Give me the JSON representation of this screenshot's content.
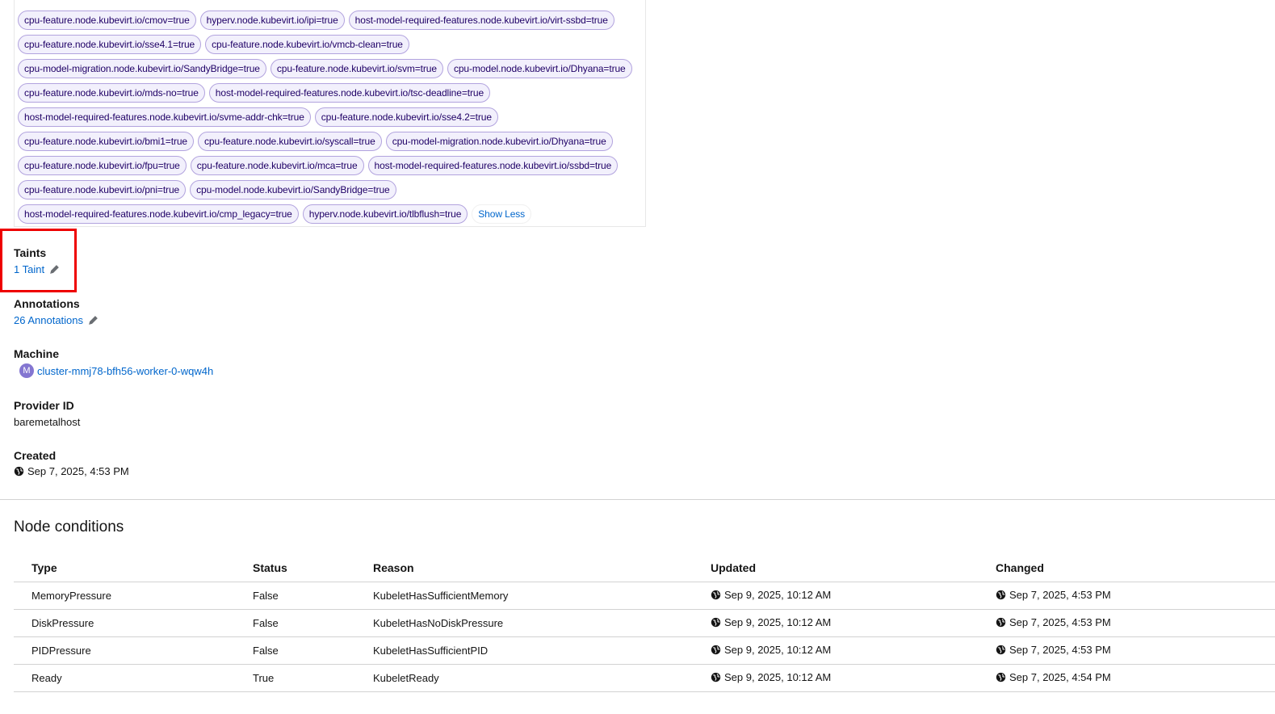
{
  "labels": {
    "rows": [
      [
        "cpu-feature.node.kubevirt.io/cmov=true",
        "hyperv.node.kubevirt.io/ipi=true",
        "host-model-required-features.node.kubevirt.io/virt-ssbd=true"
      ],
      [
        "cpu-feature.node.kubevirt.io/sse4.1=true",
        "cpu-feature.node.kubevirt.io/vmcb-clean=true"
      ],
      [
        "cpu-model-migration.node.kubevirt.io/SandyBridge=true",
        "cpu-feature.node.kubevirt.io/svm=true",
        "cpu-model.node.kubevirt.io/Dhyana=true"
      ],
      [
        "cpu-feature.node.kubevirt.io/mds-no=true",
        "host-model-required-features.node.kubevirt.io/tsc-deadline=true"
      ],
      [
        "host-model-required-features.node.kubevirt.io/svme-addr-chk=true",
        "cpu-feature.node.kubevirt.io/sse4.2=true"
      ],
      [
        "cpu-feature.node.kubevirt.io/bmi1=true",
        "cpu-feature.node.kubevirt.io/syscall=true",
        "cpu-model-migration.node.kubevirt.io/Dhyana=true"
      ],
      [
        "cpu-feature.node.kubevirt.io/fpu=true",
        "cpu-feature.node.kubevirt.io/mca=true",
        "host-model-required-features.node.kubevirt.io/ssbd=true"
      ],
      [
        "cpu-feature.node.kubevirt.io/pni=true",
        "cpu-model.node.kubevirt.io/SandyBridge=true"
      ],
      [
        "host-model-required-features.node.kubevirt.io/cmp_legacy=true",
        "hyperv.node.kubevirt.io/tlbflush=true"
      ]
    ],
    "show_less": "Show Less"
  },
  "taints": {
    "title": "Taints",
    "link": "1 Taint"
  },
  "annotations": {
    "title": "Annotations",
    "link": "26 Annotations"
  },
  "machine": {
    "title": "Machine",
    "badge": "M",
    "link": "cluster-mmj78-bfh56-worker-0-wqw4h"
  },
  "provider": {
    "title": "Provider ID",
    "value": "baremetalhost"
  },
  "created": {
    "title": "Created",
    "value": "Sep 7, 2025, 4:53 PM"
  },
  "node_conditions": {
    "title": "Node conditions",
    "headers": {
      "type": "Type",
      "status": "Status",
      "reason": "Reason",
      "updated": "Updated",
      "changed": "Changed"
    },
    "rows": [
      {
        "type": "MemoryPressure",
        "status": "False",
        "reason": "KubeletHasSufficientMemory",
        "updated": "Sep 9, 2025, 10:12 AM",
        "changed": "Sep 7, 2025, 4:53 PM"
      },
      {
        "type": "DiskPressure",
        "status": "False",
        "reason": "KubeletHasNoDiskPressure",
        "updated": "Sep 9, 2025, 10:12 AM",
        "changed": "Sep 7, 2025, 4:53 PM"
      },
      {
        "type": "PIDPressure",
        "status": "False",
        "reason": "KubeletHasSufficientPID",
        "updated": "Sep 9, 2025, 10:12 AM",
        "changed": "Sep 7, 2025, 4:53 PM"
      },
      {
        "type": "Ready",
        "status": "True",
        "reason": "KubeletReady",
        "updated": "Sep 9, 2025, 10:12 AM",
        "changed": "Sep 7, 2025, 4:54 PM"
      }
    ]
  },
  "colors": {
    "link": "#0066cc",
    "chip_bg": "#f2f0fc",
    "chip_border": "#b2a3de",
    "highlight": "#ee0000",
    "badge": "#8476d1"
  }
}
